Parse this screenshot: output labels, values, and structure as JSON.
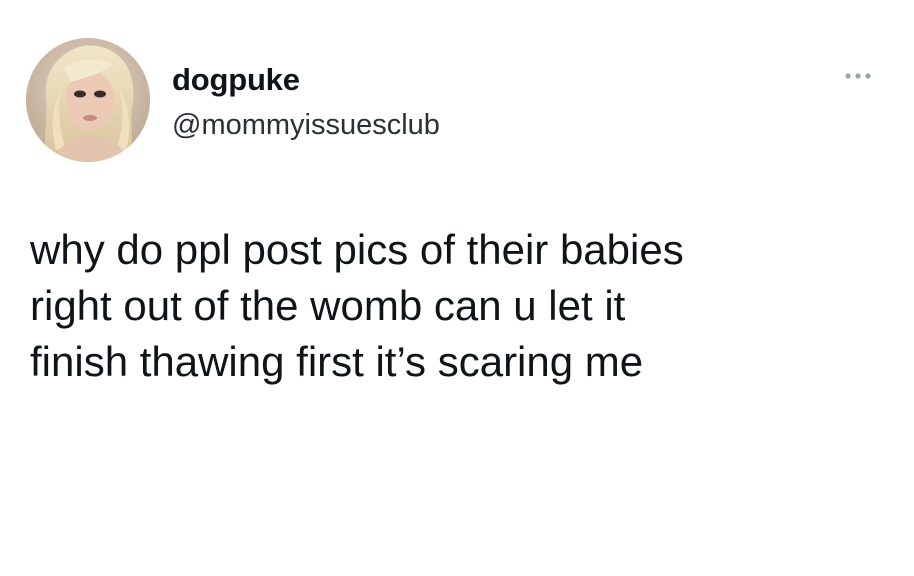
{
  "tweet": {
    "author": {
      "display_name": "dogpuke",
      "handle": "@mommyissuesclub",
      "avatar": "profile-photo"
    },
    "more_icon": "ellipsis-icon",
    "text": "why do ppl post pics of their babies\nright out of the womb can u let it\nfinish thawing first it’s scaring me"
  }
}
